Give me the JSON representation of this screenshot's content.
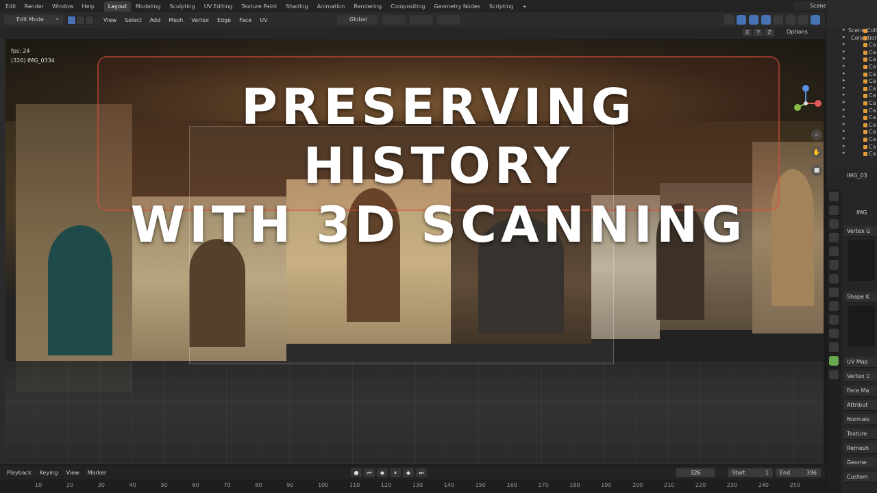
{
  "app": {
    "menu": [
      "Edit",
      "Render",
      "Window",
      "Help"
    ],
    "workspaces": [
      "Layout",
      "Modeling",
      "Sculpting",
      "UV Editing",
      "Texture Paint",
      "Shading",
      "Animation",
      "Rendering",
      "Compositing",
      "Geometry Nodes",
      "Scripting",
      "+"
    ],
    "active_workspace": "Layout",
    "scene_name": "Scene"
  },
  "viewport_header": {
    "mode": "Edit Mode",
    "menus": [
      "View",
      "Select",
      "Add",
      "Mesh",
      "Vertex",
      "Edge",
      "Face",
      "UV"
    ],
    "transform_orientation": "Global",
    "axes": [
      "X",
      "Y",
      "Z"
    ],
    "options_label": "Options"
  },
  "viewport": {
    "fps": "fps: 24",
    "object_info": "(326) IMG_0334",
    "title_line1": "PRESERVING HISTORY",
    "title_line2": "WITH 3D SCANNING"
  },
  "outliner": {
    "header": "Scene Collection",
    "collection": "Collection",
    "items": [
      "Ca",
      "Ca",
      "Ca",
      "Ca",
      "Ca",
      "Ca",
      "Ca",
      "Ca",
      "Ca",
      "Ca",
      "Ca",
      "Ca",
      "Ca",
      "Ca",
      "Ca",
      "Ca",
      "Ca"
    ]
  },
  "properties": {
    "object_name": "IMG_03",
    "mesh_name": "IMG",
    "panels": [
      "Vertex G",
      "Shape K",
      "UV Map",
      "Vertex C",
      "Face Ma",
      "Attribut",
      "Normals",
      "Texture",
      "Remesh",
      "Geome",
      "Custom"
    ]
  },
  "timeline": {
    "menus": [
      "Playback",
      "Keying",
      "View",
      "Marker"
    ],
    "current_frame": "326",
    "start_label": "Start",
    "start_value": "1",
    "end_label": "End",
    "end_value": "396",
    "ticks": [
      "10",
      "20",
      "30",
      "40",
      "50",
      "60",
      "70",
      "80",
      "90",
      "100",
      "110",
      "120",
      "130",
      "140",
      "150",
      "160",
      "170",
      "180",
      "190",
      "200",
      "210",
      "220",
      "230",
      "240",
      "250"
    ]
  }
}
